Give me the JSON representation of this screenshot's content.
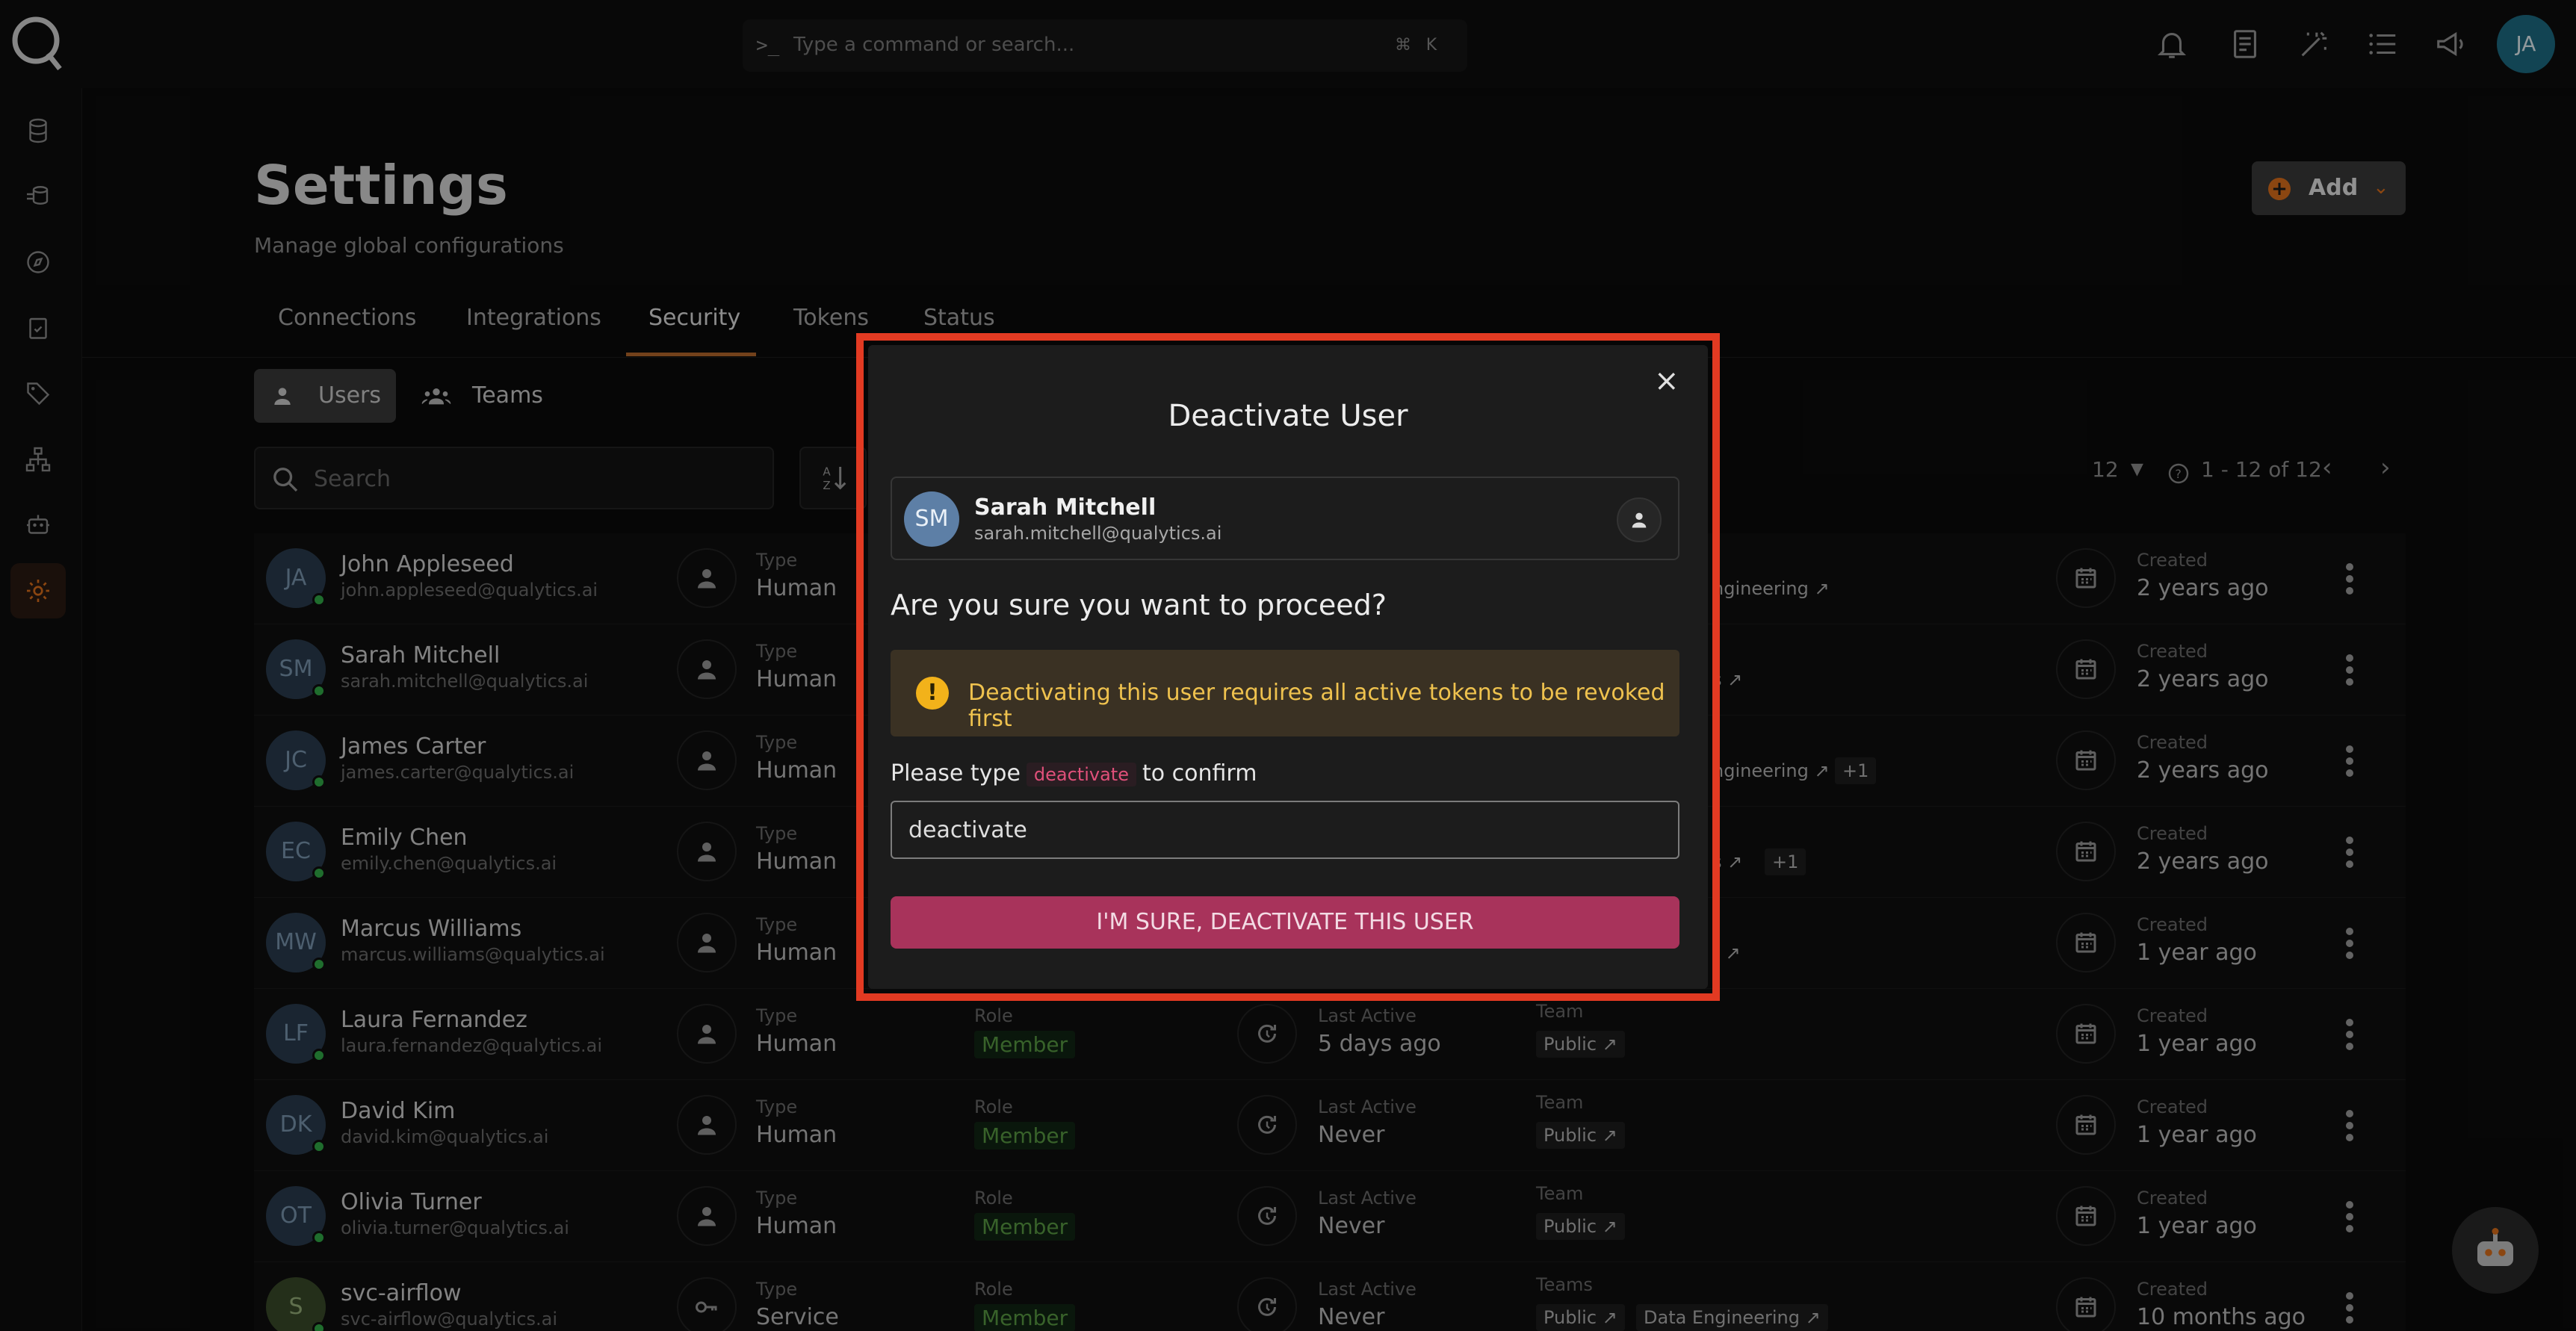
{
  "command_bar": {
    "prompt": ">_",
    "placeholder": "Type a command or search...",
    "kbd1": "⌘",
    "kbd2": "K"
  },
  "topbar": {
    "avatar_initials": "JA"
  },
  "page": {
    "title": "Settings",
    "subtitle": "Manage global configurations",
    "add_label": "Add"
  },
  "tabs": [
    "Connections",
    "Integrations",
    "Security",
    "Tokens",
    "Status"
  ],
  "active_tab": "Security",
  "subtabs": [
    "Users",
    "Teams"
  ],
  "search": {
    "placeholder": "Search"
  },
  "pager": {
    "page_size": "12",
    "range": "1 - 12 of 12"
  },
  "captions": {
    "type": "Type",
    "role": "Role",
    "last_active": "Last Active",
    "team": "Team",
    "teams": "Teams",
    "created": "Created"
  },
  "users": [
    {
      "initials": "JA",
      "name": "John Appleseed",
      "email": "john.appleseed@qualytics.ai",
      "type": "Human",
      "team_tail": "ngineering",
      "created": "2 years ago"
    },
    {
      "initials": "SM",
      "name": "Sarah Mitchell",
      "email": "sarah.mitchell@qualytics.ai",
      "type": "Human",
      "team_tail": "s",
      "created": "2 years ago"
    },
    {
      "initials": "JC",
      "name": "James Carter",
      "email": "james.carter@qualytics.ai",
      "type": "Human",
      "team_tail": "ngineering",
      "extra": "+1",
      "created": "2 years ago"
    },
    {
      "initials": "EC",
      "name": "Emily Chen",
      "email": "emily.chen@qualytics.ai",
      "type": "Human",
      "team_tail": "s",
      "extra": "+1",
      "created": "2 years ago"
    },
    {
      "initials": "MW",
      "name": "Marcus Williams",
      "email": "marcus.williams@qualytics.ai",
      "type": "Human",
      "team_tail": "r",
      "created": "1 year ago"
    },
    {
      "initials": "LF",
      "name": "Laura Fernandez",
      "email": "laura.fernandez@qualytics.ai",
      "type": "Human",
      "role": "Member",
      "last_active": "5 days ago",
      "team": "Public",
      "created": "1 year ago"
    },
    {
      "initials": "DK",
      "name": "David Kim",
      "email": "david.kim@qualytics.ai",
      "type": "Human",
      "role": "Member",
      "last_active": "Never",
      "team": "Public",
      "created": "1 year ago"
    },
    {
      "initials": "OT",
      "name": "Olivia Turner",
      "email": "olivia.turner@qualytics.ai",
      "type": "Human",
      "role": "Member",
      "last_active": "Never",
      "team": "Public",
      "created": "1 year ago"
    },
    {
      "initials": "S",
      "name": "svc-airflow",
      "email": "svc-airflow@qualytics.ai",
      "type": "Service",
      "role": "Member",
      "last_active": "Never",
      "team": "Public",
      "team2": "Data Engineering",
      "created": "10 months ago"
    }
  ],
  "modal": {
    "title": "Deactivate User",
    "close": "×",
    "user_initials": "SM",
    "user_name": "Sarah Mitchell",
    "user_email": "sarah.mitchell@qualytics.ai",
    "question": "Are you sure you want to proceed?",
    "warning_icon": "!",
    "warning": "Deactivating this user requires all active tokens to be revoked first",
    "confirm_prefix": "Please type",
    "confirm_keyword": "deactivate",
    "confirm_suffix": "to confirm",
    "input_value": "deactivate",
    "button": "I'M SURE, DEACTIVATE THIS USER"
  },
  "colors": {
    "accent": "#e0711c",
    "danger": "#a8335b",
    "warning_bg": "#3a3123",
    "highlight": "#e23a22"
  }
}
